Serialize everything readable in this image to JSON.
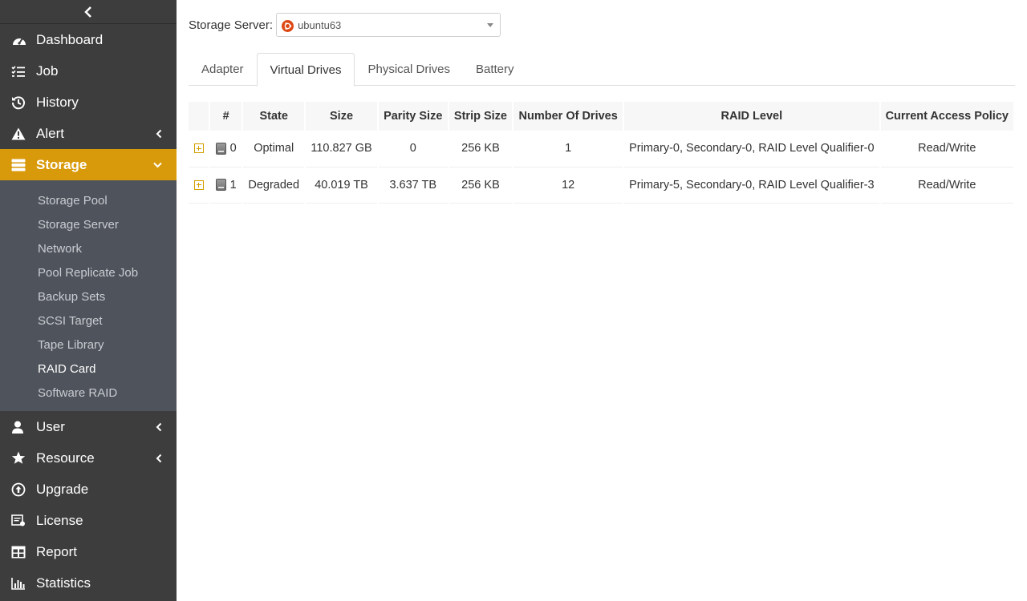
{
  "sidebar": {
    "items_top": [
      {
        "label": "Dashboard",
        "icon": "dashboard-icon"
      },
      {
        "label": "Job",
        "icon": "tasks-list-icon"
      },
      {
        "label": "History",
        "icon": "history-icon"
      },
      {
        "label": "Alert",
        "icon": "warning-icon"
      }
    ],
    "storage": {
      "label": "Storage",
      "icon": "database-icon"
    },
    "storage_sub": [
      "Storage Pool",
      "Storage Server",
      "Network",
      "Pool Replicate Job",
      "Backup Sets",
      "SCSI Target",
      "Tape Library",
      "RAID Card",
      "Software RAID"
    ],
    "items_bottom": [
      {
        "label": "User",
        "icon": "user-icon"
      },
      {
        "label": "Resource",
        "icon": "star-icon"
      },
      {
        "label": "Upgrade",
        "icon": "upload-circle-icon"
      },
      {
        "label": "License",
        "icon": "license-icon"
      },
      {
        "label": "Report",
        "icon": "table-icon"
      },
      {
        "label": "Statistics",
        "icon": "bar-chart-icon"
      }
    ],
    "active_color": "#d89a0a",
    "background_color": "#3d3d3d"
  },
  "server": {
    "label": "Storage Server:",
    "value": "ubuntu63",
    "icon": "ubuntu-icon"
  },
  "tabs": [
    "Adapter",
    "Virtual Drives",
    "Physical Drives",
    "Battery"
  ],
  "table": {
    "headers": [
      "#",
      "State",
      "Size",
      "Parity Size",
      "Strip Size",
      "Number Of Drives",
      "RAID Level",
      "Current Access Policy"
    ],
    "rows": [
      {
        "id": "0",
        "state": "Optimal",
        "size": "110.827 GB",
        "parity": "0",
        "strip": "256 KB",
        "drives": "1",
        "raid": "Primary-0, Secondary-0, RAID Level Qualifier-0",
        "access": "Read/Write"
      },
      {
        "id": "1",
        "state": "Degraded",
        "size": "40.019 TB",
        "parity": "3.637 TB",
        "strip": "256 KB",
        "drives": "12",
        "raid": "Primary-5, Secondary-0, RAID Level Qualifier-3",
        "access": "Read/Write"
      }
    ],
    "state_colors": {
      "Optimal": "#2fae2f",
      "Degraded": "#e0534a"
    }
  }
}
